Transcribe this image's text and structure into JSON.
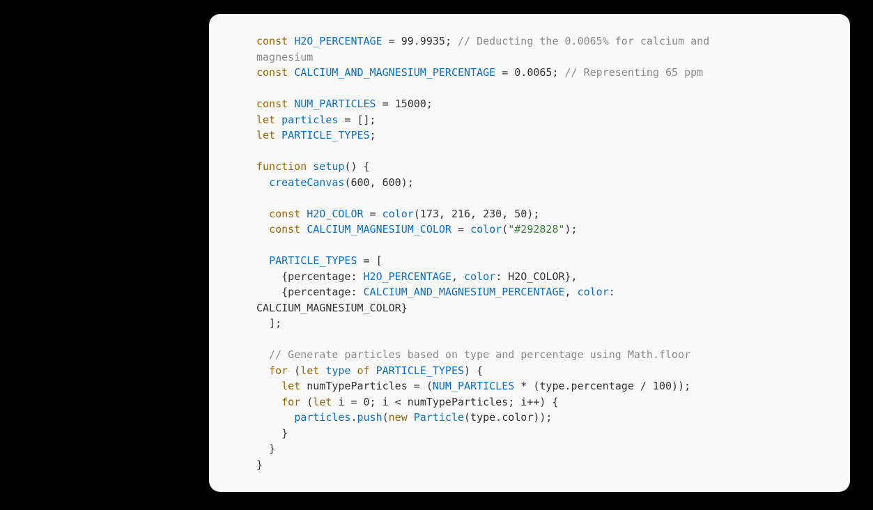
{
  "code": {
    "line1_kw": "const",
    "line1_name": "H2O_PERCENTAGE",
    "line1_eq": " = ",
    "line1_val": "99.9935",
    "line1_semi": ";",
    "line1_comment": " // Deducting the 0.0065% for calcium and ",
    "line2": "magnesium",
    "line3_kw": "const",
    "line3_name": "CALCIUM_AND_MAGNESIUM_PERCENTAGE",
    "line3_eq": " = ",
    "line3_val": "0.0065",
    "line3_semi": ";",
    "line3_comment": " // Representing 65 ppm",
    "line5_kw": "const",
    "line5_name": "NUM_PARTICLES",
    "line5_eq": " = ",
    "line5_val": "15000",
    "line5_semi": ";",
    "line6_kw": "let",
    "line6_name": "particles",
    "line6_rest": " = [];",
    "line7_kw": "let",
    "line7_name": "PARTICLE_TYPES",
    "line7_semi": ";",
    "line9_kw": "function",
    "line9_name": "setup",
    "line9_rest": "() {",
    "line10_fn": "createCanvas",
    "line10_args": "(600, 600);",
    "line12_kw": "const",
    "line12_name": "H2O_COLOR",
    "line12_eq": " = ",
    "line12_fn": "color",
    "line12_args": "(173, 216, 230, 50);",
    "line13_kw": "const",
    "line13_name": "CALCIUM_MAGNESIUM_COLOR",
    "line13_eq": " = ",
    "line13_fn": "color",
    "line13_open": "(",
    "line13_str": "\"#292828\"",
    "line13_close": ");",
    "line15_name": "PARTICLE_TYPES",
    "line15_rest": " = [",
    "line16_open": "    {percentage: ",
    "line16_val": "H2O_PERCENTAGE",
    "line16_mid": ", ",
    "line16_prop": "color",
    "line16_rest": ": H2O_COLOR},",
    "line17_open": "    {percentage: ",
    "line17_val": "CALCIUM_AND_MAGNESIUM_PERCENTAGE",
    "line17_mid": ", ",
    "line17_prop": "color",
    "line17_rest": ": ",
    "line18": "CALCIUM_MAGNESIUM_COLOR}",
    "line19": "  ];",
    "line21_comment": "  // Generate particles based on type and percentage using Math.floor",
    "line22_kw1": "for",
    "line22_open": " (",
    "line22_kw2": "let",
    "line22_sp": " ",
    "line22_var": "type",
    "line22_sp2": " ",
    "line22_kw3": "of",
    "line22_sp3": " ",
    "line22_name": "PARTICLE_TYPES",
    "line22_close": ") {",
    "line23_kw": "let",
    "line23_var": " numTypeParticles = (",
    "line23_name": "NUM_PARTICLES",
    "line23_rest": " * (type.percentage / 100));",
    "line24_kw1": "for",
    "line24_open": " (",
    "line24_kw2": "let",
    "line24_rest": " i = 0; i < numTypeParticles; i++) {",
    "line25_var": "particles",
    "line25_dot": ".",
    "line25_method": "push",
    "line25_open": "(",
    "line25_kw": "new",
    "line25_sp": " ",
    "line25_type": "Particle",
    "line25_args": "(type.color));",
    "line26": "    }",
    "line27": "  }",
    "line28": "}"
  }
}
